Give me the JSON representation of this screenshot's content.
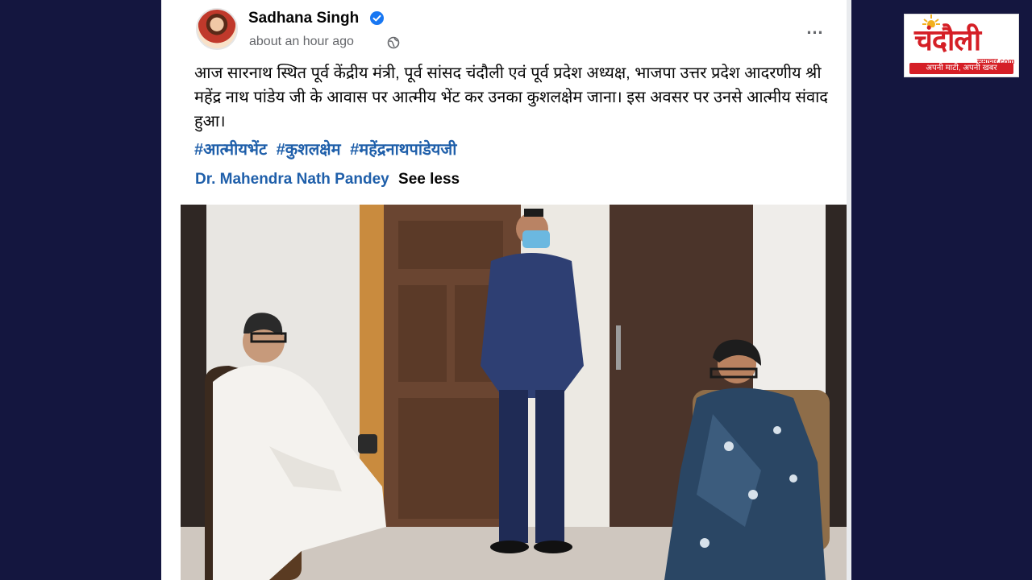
{
  "post": {
    "author": "Sadhana Singh",
    "time": "about an hour ago",
    "text": "आज सारनाथ स्थित पूर्व केंद्रीय मंत्री, पूर्व सांसद चंदौली एवं पूर्व प्रदेश अध्यक्ष, भाजपा उत्तर प्रदेश आदरणीय श्री महेंद्र नाथ पांडेय जी के आवास पर आत्मीय भेंट कर उनका कुशलक्षेम जाना। इस अवसर पर उनसे आत्मीय संवाद हुआ।",
    "hashtags": [
      "#आत्मीयभेंट",
      "#कुशलक्षेम",
      "#महेंद्रनाथपांडेयजी"
    ],
    "tagged_person": "Dr. Mahendra Nath Pandey",
    "see_less": "See less",
    "more_icon": "…"
  },
  "logo": {
    "word": "चंदौली",
    "sub": "समाचार.com",
    "tagline": "अपनी माटी, अपनी खबर"
  },
  "colors": {
    "background": "#14163f",
    "link": "#1f5faa",
    "verified": "#1877f2",
    "logo_red": "#d51f26"
  },
  "icons": [
    "verified-badge-icon",
    "globe-icon",
    "more-options-icon"
  ]
}
